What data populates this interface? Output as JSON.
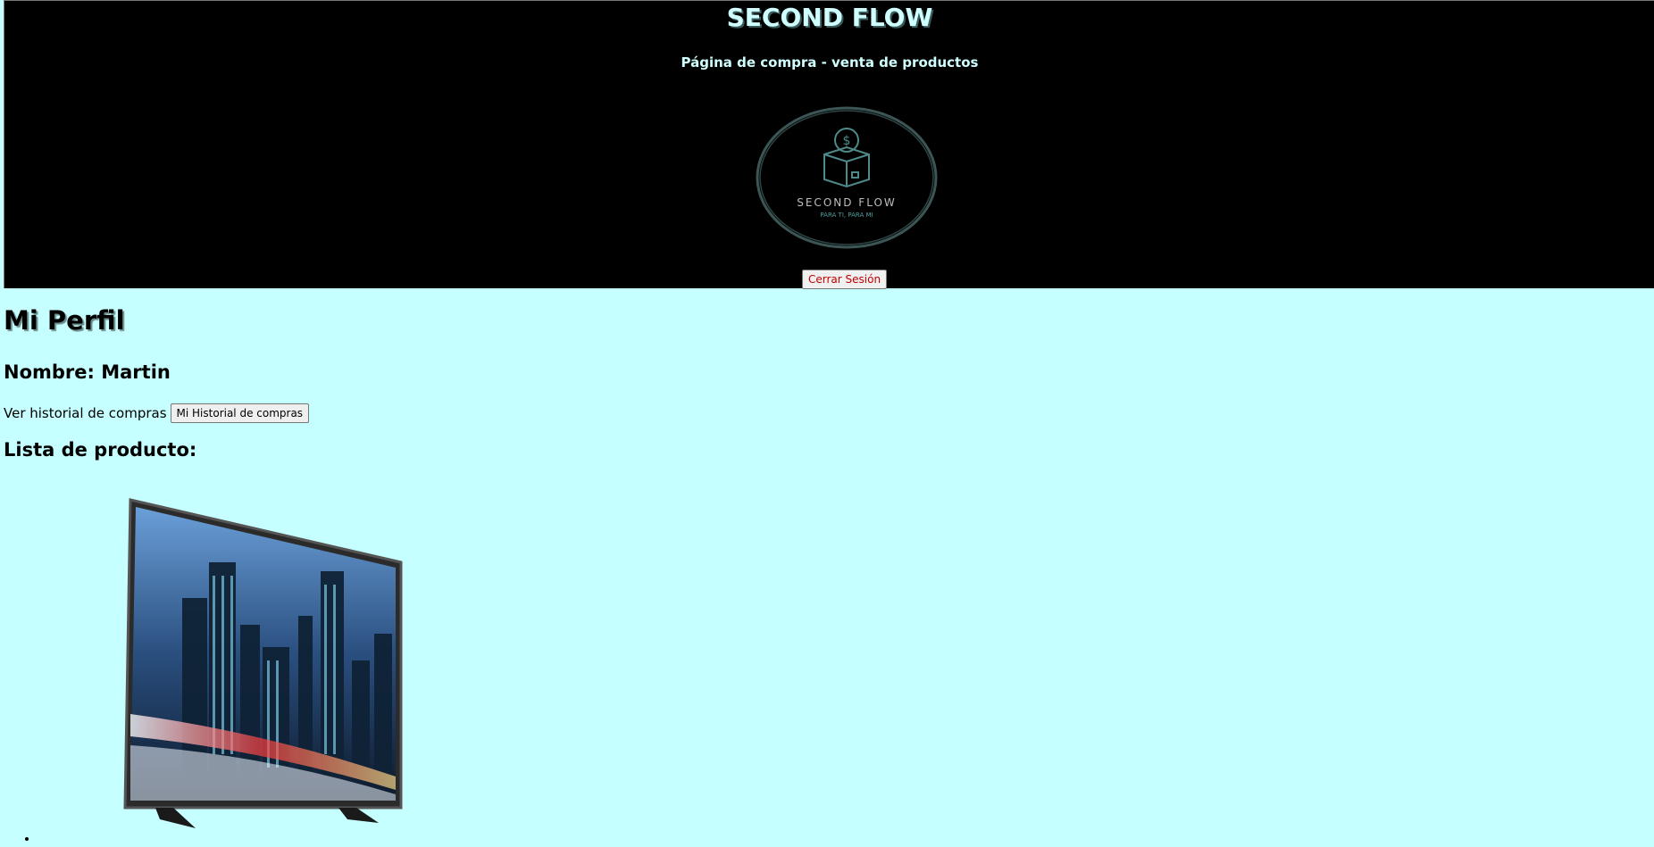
{
  "header": {
    "title": "SECOND FLOW",
    "subtitle": "Página de compra - venta de productos",
    "logout_label": "Cerrar Sesión",
    "logo": {
      "name": "SECOND FLOW",
      "tagline": "PARA TI, PARA MI",
      "icon": "money-box-icon"
    }
  },
  "profile": {
    "title": "Mi Perfil",
    "name_line": "Nombre: Martin",
    "history_text": "Ver historial de compras",
    "history_button": "Mi Historial de compras",
    "list_title": "Lista de producto:"
  },
  "products": [
    {
      "image": "tv-image"
    }
  ],
  "colors": {
    "header_bg": "#000000",
    "body_bg": "#c6ffff",
    "title_color": "#cfffff",
    "logout_text": "#c00000"
  }
}
